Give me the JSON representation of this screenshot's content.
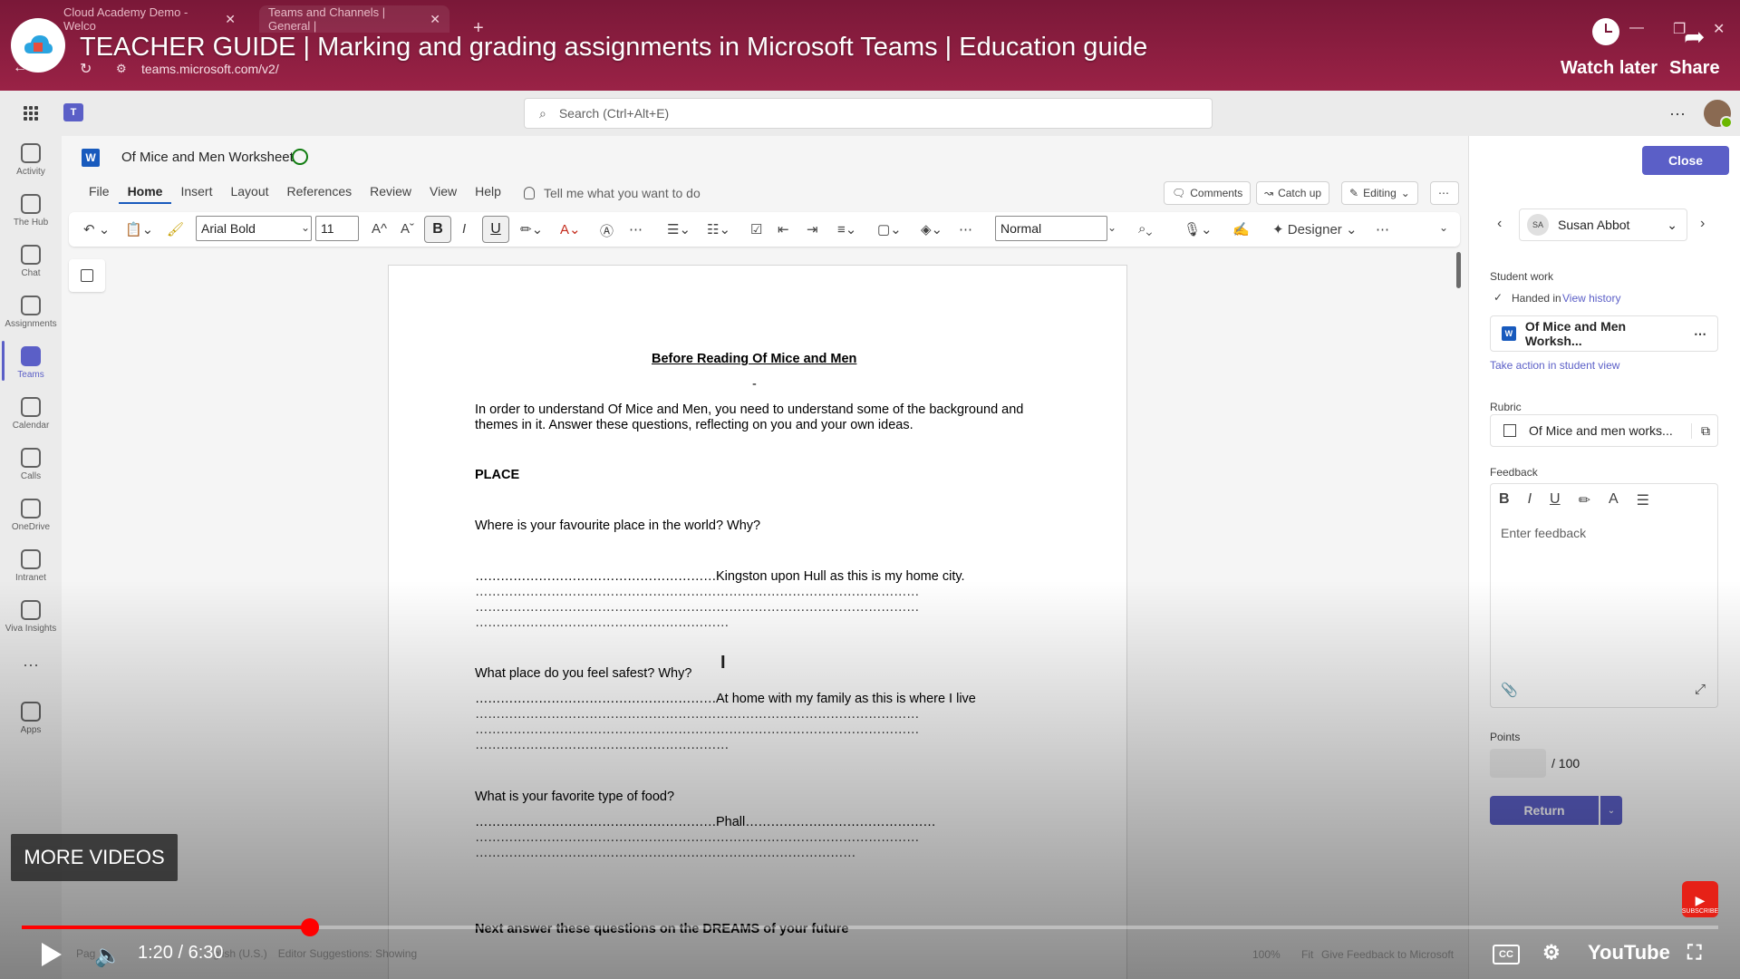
{
  "browser": {
    "tabs": [
      {
        "label": "Cloud Academy Demo - Welco"
      },
      {
        "label": "Teams and Channels | General |"
      }
    ],
    "url": "teams.microsoft.com/v2/"
  },
  "youtube": {
    "title": "TEACHER GUIDE | Marking and grading assignments in Microsoft Teams | Education guide",
    "watch_later": "Watch later",
    "share": "Share",
    "more_videos": "MORE VIDEOS",
    "time": "1:20 / 6:30",
    "progress_fraction": 0.17,
    "brand": "YouTube",
    "subscribe": "SUBSCRIBE"
  },
  "teams": {
    "search_placeholder": "Search (Ctrl+Alt+E)",
    "rail": [
      {
        "label": "Activity",
        "icon": "bell-icon"
      },
      {
        "label": "The Hub",
        "icon": "cloud-icon"
      },
      {
        "label": "Chat",
        "icon": "chat-icon"
      },
      {
        "label": "Assignments",
        "icon": "backpack-icon"
      },
      {
        "label": "Teams",
        "icon": "teams-icon"
      },
      {
        "label": "Calendar",
        "icon": "calendar-icon"
      },
      {
        "label": "Calls",
        "icon": "phone-icon"
      },
      {
        "label": "OneDrive",
        "icon": "onedrive-icon"
      },
      {
        "label": "Intranet",
        "icon": "cloud-icon"
      },
      {
        "label": "Viva Insights",
        "icon": "insights-icon"
      },
      {
        "label": "Apps",
        "icon": "apps-icon"
      }
    ]
  },
  "word": {
    "doc_title": "Of Mice and Men Worksheet",
    "menu": [
      "File",
      "Home",
      "Insert",
      "Layout",
      "References",
      "Review",
      "View",
      "Help"
    ],
    "tell_me": "Tell me what you want to do",
    "buttons": {
      "comments": "Comments",
      "catch_up": "Catch up",
      "editing": "Editing"
    },
    "ribbon": {
      "font": "Arial Bold",
      "size": "11",
      "style": "Normal",
      "designer": "Designer"
    },
    "status": {
      "page": "Pag",
      "lang": "glish (U.S.)",
      "editor": "Editor Suggestions: Showing",
      "zoom": "100%",
      "fit": "Fit",
      "feedback": "Give Feedback to Microsoft"
    }
  },
  "document": {
    "heading": "Before Reading Of Mice and Men",
    "intro_1": "In order to understand Of Mice and Men, you need to understand some of the background and",
    "intro_2": "themes in it. Answer these questions, reflecting on you and your own ideas.",
    "section_place": "PLACE",
    "q1": "Where is your favourite place in the world? Why?",
    "a1_line1": "Kingston upon Hull as this is my home city.",
    "q2": "What place do you feel safest? Why?",
    "a2_line1": "At home with my family as this is where I live",
    "q3": "What is your favorite type of food?",
    "a3_line1": "Phall",
    "next": "Next answer these questions on the DREAMS of your future"
  },
  "grading": {
    "close": "Close",
    "student_initials": "SA",
    "student_name": "Susan Abbot",
    "student_work_label": "Student work",
    "handed_in": "Handed in",
    "view_history": "View history",
    "file_name": "Of Mice and Men Worksh...",
    "take_action": "Take action in student view",
    "rubric_label": "Rubric",
    "rubric_name": "Of Mice and men works...",
    "feedback_label": "Feedback",
    "feedback_placeholder": "Enter feedback",
    "points_label": "Points",
    "points_total": "/ 100",
    "return": "Return"
  },
  "colors": {
    "teams_purple": "#5b5fc7",
    "word_blue": "#185abd",
    "yt_red": "#ff0000"
  }
}
